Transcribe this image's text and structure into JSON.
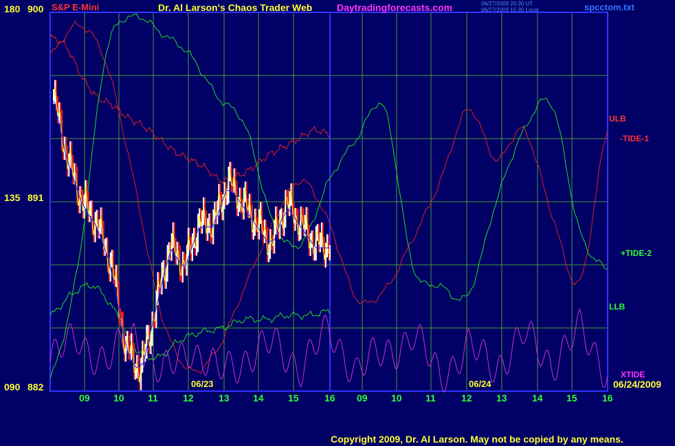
{
  "header": {
    "instrument": "S&P E-Mini",
    "title": "Dr. Al Larson's Chaos Trader Web",
    "site": "Daytradingforecasts.com",
    "timestamp_ut": "06/27/2009 20:30 UT",
    "timestamp_local": "06/27/2009 15:30 Local",
    "filename": "spcctom.txt"
  },
  "left_axis": {
    "top": {
      "angle": "180",
      "price": "900"
    },
    "mid": {
      "angle": "135",
      "price": "891"
    },
    "bottom": {
      "angle": "090",
      "price": "882"
    }
  },
  "date_labels": {
    "day1": "06/23",
    "day2": "06/24",
    "end": "06/24/2009"
  },
  "hour_labels": [
    "09",
    "10",
    "11",
    "12",
    "13",
    "14",
    "15",
    "16",
    "09",
    "10",
    "11",
    "12",
    "13",
    "14",
    "15",
    "16"
  ],
  "curve_labels": {
    "ulb": "ULB",
    "tide1": "-TIDE-1",
    "tide2": "+TIDE-2",
    "llb": "LLB",
    "xtide": "XTIDE"
  },
  "footer": {
    "copyright": "Copyright 2009, Dr. Al Larson.  May not be copied by any means."
  },
  "colors": {
    "background": "#000066",
    "grid": "#4a9a3a",
    "frame": "#3333ff",
    "red": "#dd2222",
    "green": "#22dd22",
    "magenta": "#cc33cc",
    "yellow": "#ffff33",
    "blue_ma": "#2222ff",
    "white": "#ffffff",
    "title_magenta": "#ff33ff"
  },
  "chart_data": {
    "type": "line",
    "y_range_price": [
      882,
      900
    ],
    "y_range_angle": [
      90,
      180
    ],
    "x_hours": [
      9,
      10,
      11,
      12,
      13,
      14,
      15,
      16,
      9,
      10,
      11,
      12,
      13,
      14,
      15,
      16
    ],
    "grid": true,
    "series": [
      {
        "name": "ULB",
        "color": "#dd2222",
        "values": [
          174,
          172,
          165,
          160,
          158,
          155,
          153,
          150,
          147,
          145,
          143,
          140,
          141,
          143,
          146,
          148,
          150,
          152,
          151
        ]
      },
      {
        "name": "-TIDE-1",
        "color": "#dd2222",
        "values": [
          170,
          177,
          168,
          140,
          108,
          95,
          100,
          115,
          130,
          140,
          130,
          112,
          114,
          126,
          140,
          157,
          145,
          152,
          132,
          116,
          152
        ]
      },
      {
        "name": "+TIDE-2",
        "color": "#22dd22",
        "values": [
          93,
          120,
          170,
          179,
          175,
          170,
          160,
          153,
          130,
          125,
          140,
          150,
          157,
          120,
          115,
          113,
          135,
          152,
          158,
          128,
          119
        ]
      },
      {
        "name": "LLB",
        "color": "#22dd22",
        "values": [
          108,
          113,
          115,
          109,
          100,
          98,
          102,
          104,
          105,
          107,
          107,
          108,
          108,
          109
        ]
      },
      {
        "name": "XTIDE",
        "color": "#cc33cc",
        "values": [
          97,
          103,
          96,
          104,
          93,
          101,
          94,
          98,
          101,
          96,
          104,
          95,
          99,
          103,
          94,
          100,
          96,
          103,
          97,
          104,
          95
        ]
      }
    ],
    "price_approx": [
      896,
      893,
      891,
      890,
      888,
      884,
      883,
      886,
      889,
      888,
      890,
      890,
      892,
      891,
      890,
      889,
      891,
      890,
      889,
      889
    ]
  }
}
